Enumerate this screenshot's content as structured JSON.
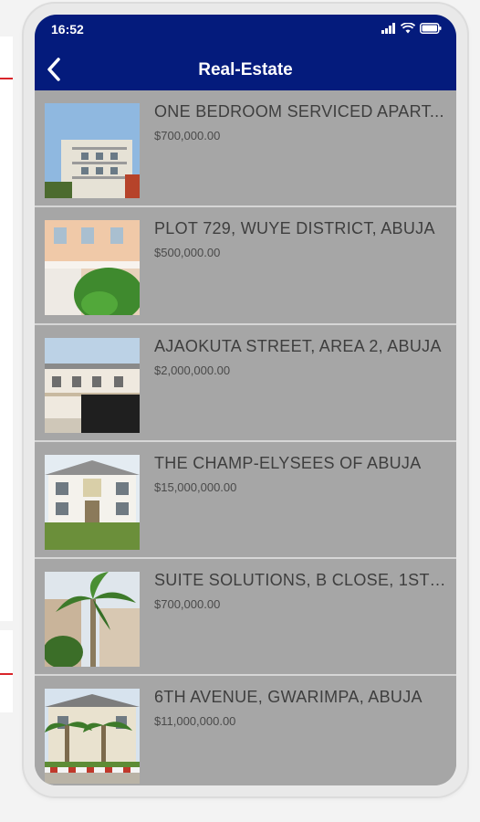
{
  "status_bar": {
    "time": "16:52"
  },
  "header": {
    "title": "Real-Estate"
  },
  "listings": [
    {
      "title": "ONE BEDROOM SERVICED APART...",
      "price": "$700,000.00"
    },
    {
      "title": "PLOT 729, WUYE DISTRICT, ABUJA",
      "price": "$500,000.00"
    },
    {
      "title": "AJAOKUTA STREET, AREA 2, ABUJA",
      "price": "$2,000,000.00"
    },
    {
      "title": "THE CHAMP-ELYSEES OF ABUJA",
      "price": "$15,000,000.00"
    },
    {
      "title": "SUITE SOLUTIONS, B CLOSE, 1ST ...",
      "price": "$700,000.00"
    },
    {
      "title": "6TH AVENUE, GWARIMPA, ABUJA",
      "price": "$11,000,000.00"
    }
  ],
  "colors": {
    "header": "#041b7c",
    "list_bg": "#a6a6a6",
    "divider": "#d6d6d6",
    "text": "#3e3e3e"
  }
}
